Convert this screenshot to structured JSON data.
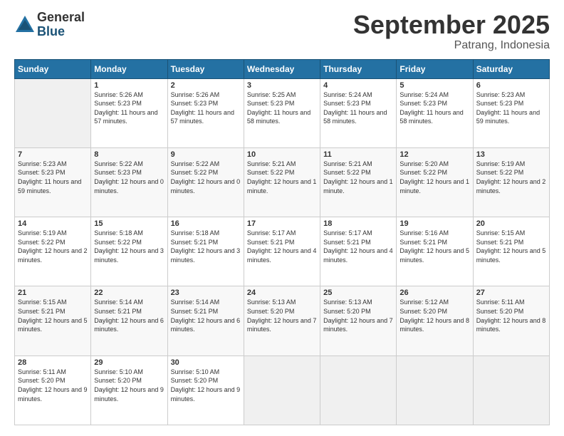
{
  "logo": {
    "general": "General",
    "blue": "Blue"
  },
  "header": {
    "month": "September 2025",
    "location": "Patrang, Indonesia"
  },
  "days_of_week": [
    "Sunday",
    "Monday",
    "Tuesday",
    "Wednesday",
    "Thursday",
    "Friday",
    "Saturday"
  ],
  "weeks": [
    [
      {
        "day": "",
        "sunrise": "",
        "sunset": "",
        "daylight": "",
        "empty": true
      },
      {
        "day": "1",
        "sunrise": "Sunrise: 5:26 AM",
        "sunset": "Sunset: 5:23 PM",
        "daylight": "Daylight: 11 hours and 57 minutes."
      },
      {
        "day": "2",
        "sunrise": "Sunrise: 5:26 AM",
        "sunset": "Sunset: 5:23 PM",
        "daylight": "Daylight: 11 hours and 57 minutes."
      },
      {
        "day": "3",
        "sunrise": "Sunrise: 5:25 AM",
        "sunset": "Sunset: 5:23 PM",
        "daylight": "Daylight: 11 hours and 58 minutes."
      },
      {
        "day": "4",
        "sunrise": "Sunrise: 5:24 AM",
        "sunset": "Sunset: 5:23 PM",
        "daylight": "Daylight: 11 hours and 58 minutes."
      },
      {
        "day": "5",
        "sunrise": "Sunrise: 5:24 AM",
        "sunset": "Sunset: 5:23 PM",
        "daylight": "Daylight: 11 hours and 58 minutes."
      },
      {
        "day": "6",
        "sunrise": "Sunrise: 5:23 AM",
        "sunset": "Sunset: 5:23 PM",
        "daylight": "Daylight: 11 hours and 59 minutes."
      }
    ],
    [
      {
        "day": "7",
        "sunrise": "Sunrise: 5:23 AM",
        "sunset": "Sunset: 5:23 PM",
        "daylight": "Daylight: 11 hours and 59 minutes."
      },
      {
        "day": "8",
        "sunrise": "Sunrise: 5:22 AM",
        "sunset": "Sunset: 5:23 PM",
        "daylight": "Daylight: 12 hours and 0 minutes."
      },
      {
        "day": "9",
        "sunrise": "Sunrise: 5:22 AM",
        "sunset": "Sunset: 5:22 PM",
        "daylight": "Daylight: 12 hours and 0 minutes."
      },
      {
        "day": "10",
        "sunrise": "Sunrise: 5:21 AM",
        "sunset": "Sunset: 5:22 PM",
        "daylight": "Daylight: 12 hours and 1 minute."
      },
      {
        "day": "11",
        "sunrise": "Sunrise: 5:21 AM",
        "sunset": "Sunset: 5:22 PM",
        "daylight": "Daylight: 12 hours and 1 minute."
      },
      {
        "day": "12",
        "sunrise": "Sunrise: 5:20 AM",
        "sunset": "Sunset: 5:22 PM",
        "daylight": "Daylight: 12 hours and 1 minute."
      },
      {
        "day": "13",
        "sunrise": "Sunrise: 5:19 AM",
        "sunset": "Sunset: 5:22 PM",
        "daylight": "Daylight: 12 hours and 2 minutes."
      }
    ],
    [
      {
        "day": "14",
        "sunrise": "Sunrise: 5:19 AM",
        "sunset": "Sunset: 5:22 PM",
        "daylight": "Daylight: 12 hours and 2 minutes."
      },
      {
        "day": "15",
        "sunrise": "Sunrise: 5:18 AM",
        "sunset": "Sunset: 5:22 PM",
        "daylight": "Daylight: 12 hours and 3 minutes."
      },
      {
        "day": "16",
        "sunrise": "Sunrise: 5:18 AM",
        "sunset": "Sunset: 5:21 PM",
        "daylight": "Daylight: 12 hours and 3 minutes."
      },
      {
        "day": "17",
        "sunrise": "Sunrise: 5:17 AM",
        "sunset": "Sunset: 5:21 PM",
        "daylight": "Daylight: 12 hours and 4 minutes."
      },
      {
        "day": "18",
        "sunrise": "Sunrise: 5:17 AM",
        "sunset": "Sunset: 5:21 PM",
        "daylight": "Daylight: 12 hours and 4 minutes."
      },
      {
        "day": "19",
        "sunrise": "Sunrise: 5:16 AM",
        "sunset": "Sunset: 5:21 PM",
        "daylight": "Daylight: 12 hours and 5 minutes."
      },
      {
        "day": "20",
        "sunrise": "Sunrise: 5:15 AM",
        "sunset": "Sunset: 5:21 PM",
        "daylight": "Daylight: 12 hours and 5 minutes."
      }
    ],
    [
      {
        "day": "21",
        "sunrise": "Sunrise: 5:15 AM",
        "sunset": "Sunset: 5:21 PM",
        "daylight": "Daylight: 12 hours and 5 minutes."
      },
      {
        "day": "22",
        "sunrise": "Sunrise: 5:14 AM",
        "sunset": "Sunset: 5:21 PM",
        "daylight": "Daylight: 12 hours and 6 minutes."
      },
      {
        "day": "23",
        "sunrise": "Sunrise: 5:14 AM",
        "sunset": "Sunset: 5:21 PM",
        "daylight": "Daylight: 12 hours and 6 minutes."
      },
      {
        "day": "24",
        "sunrise": "Sunrise: 5:13 AM",
        "sunset": "Sunset: 5:20 PM",
        "daylight": "Daylight: 12 hours and 7 minutes."
      },
      {
        "day": "25",
        "sunrise": "Sunrise: 5:13 AM",
        "sunset": "Sunset: 5:20 PM",
        "daylight": "Daylight: 12 hours and 7 minutes."
      },
      {
        "day": "26",
        "sunrise": "Sunrise: 5:12 AM",
        "sunset": "Sunset: 5:20 PM",
        "daylight": "Daylight: 12 hours and 8 minutes."
      },
      {
        "day": "27",
        "sunrise": "Sunrise: 5:11 AM",
        "sunset": "Sunset: 5:20 PM",
        "daylight": "Daylight: 12 hours and 8 minutes."
      }
    ],
    [
      {
        "day": "28",
        "sunrise": "Sunrise: 5:11 AM",
        "sunset": "Sunset: 5:20 PM",
        "daylight": "Daylight: 12 hours and 9 minutes."
      },
      {
        "day": "29",
        "sunrise": "Sunrise: 5:10 AM",
        "sunset": "Sunset: 5:20 PM",
        "daylight": "Daylight: 12 hours and 9 minutes."
      },
      {
        "day": "30",
        "sunrise": "Sunrise: 5:10 AM",
        "sunset": "Sunset: 5:20 PM",
        "daylight": "Daylight: 12 hours and 9 minutes."
      },
      {
        "day": "",
        "empty": true
      },
      {
        "day": "",
        "empty": true
      },
      {
        "day": "",
        "empty": true
      },
      {
        "day": "",
        "empty": true
      }
    ]
  ]
}
